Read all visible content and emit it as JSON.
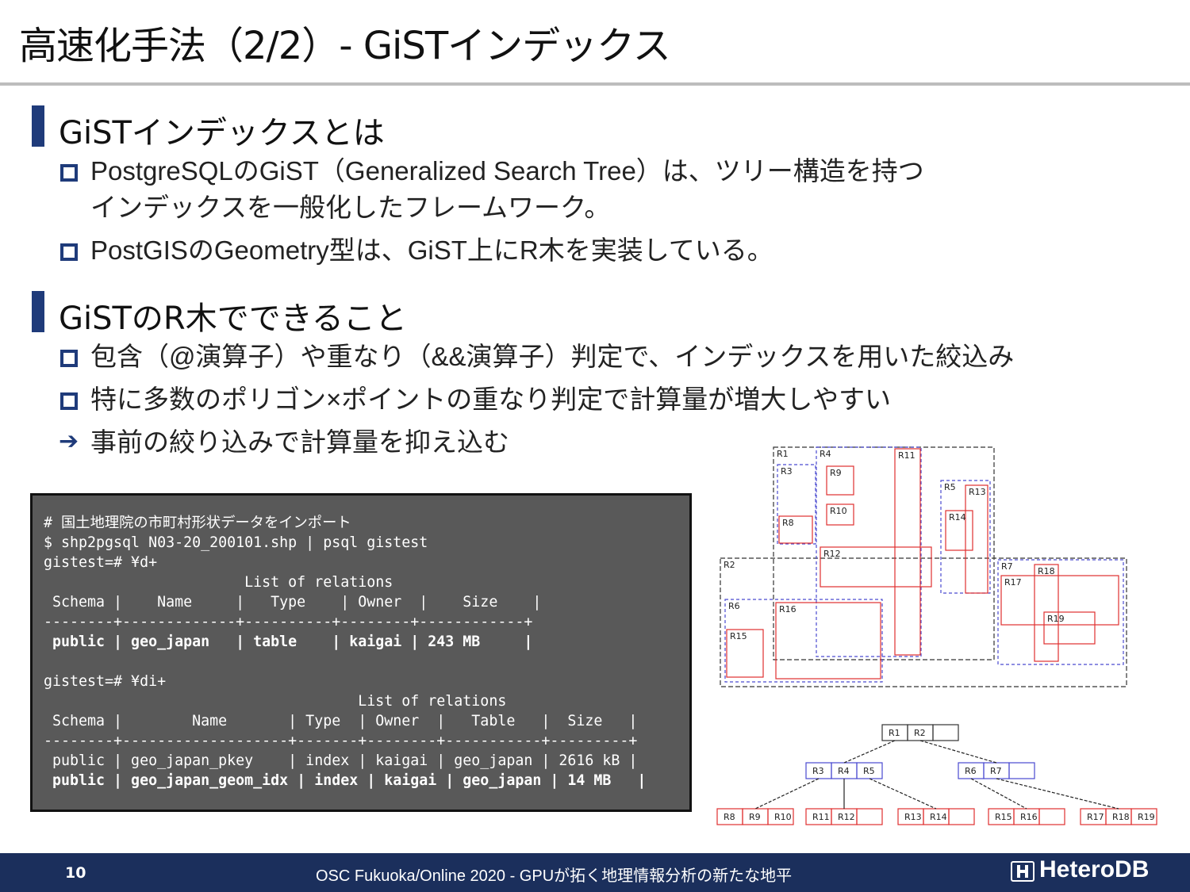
{
  "slide": {
    "title": "高速化手法（2/2）- GiSTインデックス",
    "sections": [
      {
        "heading": "GiSTインデックスとは",
        "bullets": [
          "PostgreSQLのGiST（Generalized Search Tree）は、ツリー構造を持つ",
          "インデックスを一般化したフレームワーク。",
          "PostGISのGeometry型は、GiST上にR木を実装している。"
        ]
      },
      {
        "heading": "GiSTのR木でできること",
        "bullets": [
          "包含（@演算子）や重なり（&&演算子）判定で、インデックスを用いた絞込み",
          "特に多数のポリゴン×ポイントの重なり判定で計算量が増大しやすい",
          "事前の絞り込みで計算量を抑え込む"
        ]
      }
    ]
  },
  "terminal": {
    "lines": [
      "# 国土地理院の市町村形状データをインポート",
      "$ shp2pgsql N03-20_200101.shp | psql gistest",
      "gistest=# ¥d+",
      "                       List of relations",
      " Schema |    Name     |   Type    | Owner  |    Size    |",
      "--------+-------------+----------+--------+------------+",
      " public | geo_japan   | table    | kaigai | 243 MB     |",
      "",
      "gistest=# ¥di+",
      "                                    List of relations",
      " Schema |        Name       | Type  | Owner  |   Table   |  Size   |",
      "--------+-------------------+-------+--------+-----------+---------+",
      " public | geo_japan_pkey    | index | kaigai | geo_japan | 2616 kB |",
      " public | geo_japan_geom_idx | index | kaigai | geo_japan | 14 MB   |"
    ]
  },
  "diagram": {
    "region_labels": [
      "R1",
      "R2",
      "R3",
      "R4",
      "R5",
      "R6",
      "R7",
      "R8",
      "R9",
      "R10",
      "R11",
      "R12",
      "R13",
      "R14",
      "R15",
      "R16",
      "R17",
      "R18",
      "R19"
    ],
    "tree": {
      "root": [
        "R1",
        "R2"
      ],
      "level1": [
        [
          "R3",
          "R4",
          "R5"
        ],
        [
          "R6",
          "R7"
        ]
      ],
      "leaves": [
        [
          "R8",
          "R9",
          "R10"
        ],
        [
          "R11",
          "R12"
        ],
        [
          "R13",
          "R14"
        ],
        [
          "R15",
          "R16"
        ],
        [
          "R17",
          "R18",
          "R19"
        ]
      ]
    },
    "colors": {
      "group": "#333333",
      "mid": "#4a4ad0",
      "leaf": "#e03030"
    }
  },
  "footer": {
    "page": "10",
    "conference": "OSC Fukuoka/Online 2020 - GPUが拓く地理情報分析の新たな地平",
    "logo": "HeteroDB"
  }
}
